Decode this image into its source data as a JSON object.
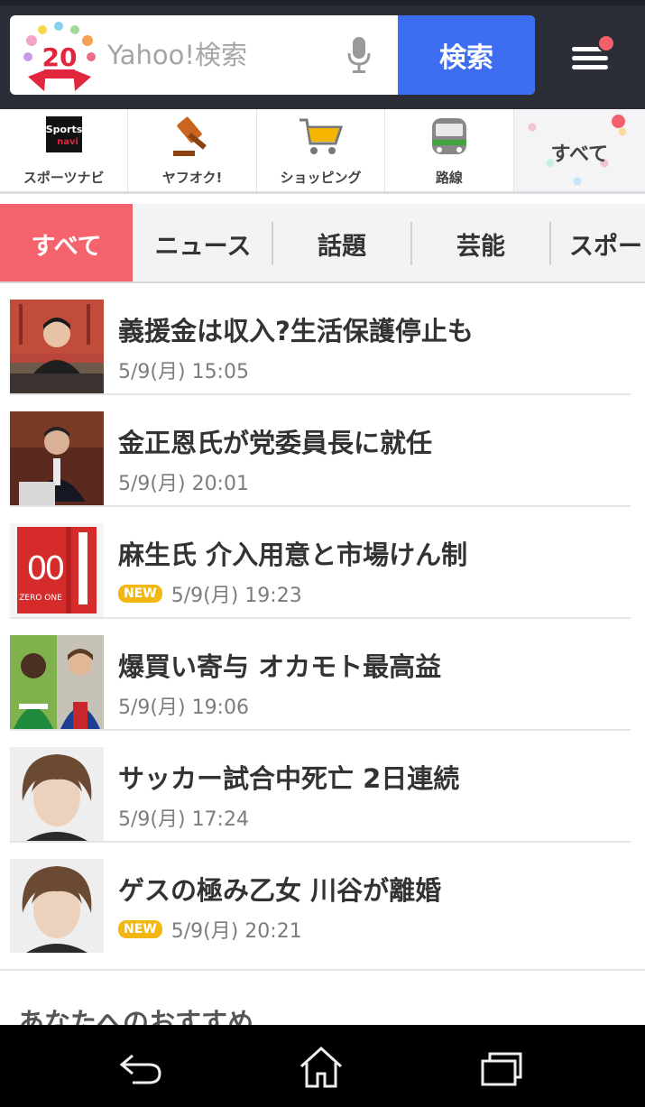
{
  "header": {
    "logo_text": "20",
    "search_placeholder": "Yahoo!検索",
    "search_button": "検索",
    "colors": {
      "header_bg": "#2b2e36",
      "search_button_bg": "#3d6ef1",
      "notification_dot": "#f2606b"
    }
  },
  "services": [
    {
      "label": "スポーツナビ",
      "icon": "sportsnavi-icon"
    },
    {
      "label": "ヤフオク!",
      "icon": "auction-gavel-icon"
    },
    {
      "label": "ショッピング",
      "icon": "shopping-cart-icon"
    },
    {
      "label": "路線",
      "icon": "train-icon"
    },
    {
      "label": "すべて",
      "icon": "all-services-icon"
    }
  ],
  "tabs": [
    {
      "label": "すべて",
      "active": true
    },
    {
      "label": "ニュース",
      "active": false
    },
    {
      "label": "話題",
      "active": false
    },
    {
      "label": "芸能",
      "active": false
    },
    {
      "label": "スポー",
      "active": false
    }
  ],
  "news": [
    {
      "headline": "義援金は収入?生活保護停止も",
      "time": "5/9(月) 15:05",
      "new": false
    },
    {
      "headline": "金正恩氏が党委員長に就任",
      "time": "5/9(月) 20:01",
      "new": false
    },
    {
      "headline": "麻生氏 介入用意と市場けん制",
      "time": "5/9(月) 19:23",
      "new": true
    },
    {
      "headline": "爆買い寄与 オカモト最高益",
      "time": "5/9(月) 19:06",
      "new": false
    },
    {
      "headline": "サッカー試合中死亡 2日連続",
      "time": "5/9(月) 17:24",
      "new": false
    },
    {
      "headline": "ゲスの極み乙女 川谷が離婚",
      "time": "5/9(月) 20:21",
      "new": true
    }
  ],
  "badge_new": "NEW",
  "thumb_text": {
    "sportsnavi_top": "Sports",
    "sportsnavi_bottom": "navi",
    "zero_one": "ZERO ONE"
  },
  "recommend_title": "あなたへのおすすめ"
}
